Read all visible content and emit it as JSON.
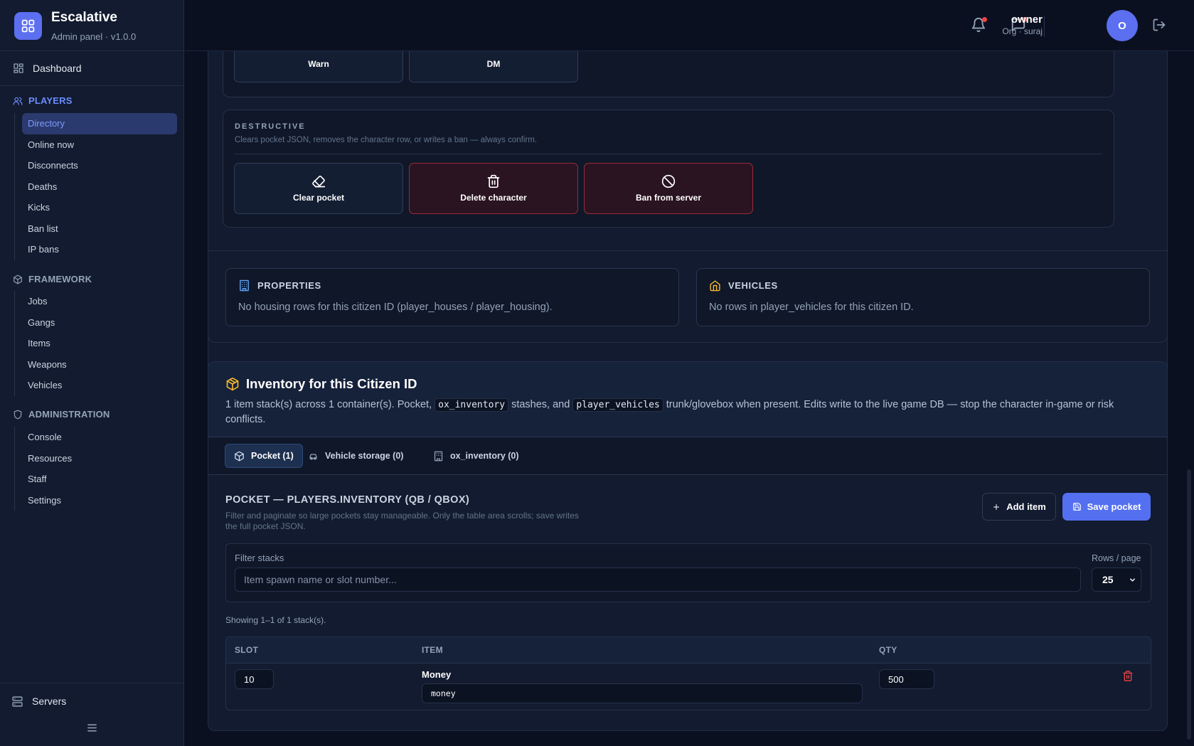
{
  "brand": {
    "title": "Escalative",
    "subtitle": "Admin panel · v1.0.0",
    "logo_icon": "grid-icon"
  },
  "sidebar": {
    "dashboard": "Dashboard",
    "sections": [
      {
        "label": "PLAYERS",
        "icon": "users-icon",
        "active": true,
        "items": [
          "Directory",
          "Online now",
          "Disconnects",
          "Deaths",
          "Kicks",
          "Ban list",
          "IP bans"
        ]
      },
      {
        "label": "FRAMEWORK",
        "icon": "cube-icon",
        "items": [
          "Jobs",
          "Gangs",
          "Items",
          "Weapons",
          "Vehicles"
        ]
      },
      {
        "label": "ADMINISTRATION",
        "icon": "shield-icon",
        "items": [
          "Console",
          "Resources",
          "Staff",
          "Settings"
        ]
      }
    ],
    "active_item": "Directory",
    "servers": "Servers"
  },
  "topbar": {
    "user_name": "owner",
    "user_sub": "Org · suraj",
    "avatar_initial": "O",
    "accent": "#5b6ff0",
    "notification_dot_color": "#ef4444"
  },
  "actions": {
    "warn": "Warn",
    "dm": "DM",
    "destructive_label": "DESTRUCTIVE",
    "destructive_desc": "Clears pocket JSON, removes the character row, or writes a ban — always confirm.",
    "clear_pocket": "Clear pocket",
    "delete_character": "Delete character",
    "ban_from_server": "Ban from server"
  },
  "properties": {
    "title": "PROPERTIES",
    "body": "No housing rows for this citizen ID (player_houses / player_housing)."
  },
  "vehicles": {
    "title": "VEHICLES",
    "body": "No rows in player_vehicles for this citizen ID."
  },
  "inventory": {
    "title": "Inventory for this Citizen ID",
    "desc_1": "1 item stack(s) across 1 container(s). Pocket, ",
    "code_1": "ox_inventory",
    "desc_2": " stashes, and ",
    "code_2": "player_vehicles",
    "desc_3": " trunk/glovebox when present. Edits write to the live game DB — stop the character in-game or risk conflicts.",
    "tabs": [
      {
        "label": "Pocket (1)",
        "icon": "cube-icon",
        "active": true
      },
      {
        "label": "Vehicle storage (0)",
        "icon": "car-icon"
      },
      {
        "label": "ox_inventory (0)",
        "icon": "building-icon"
      }
    ],
    "pocket_title": "POCKET — PLAYERS.INVENTORY (QB / QBOX)",
    "pocket_desc": "Filter and paginate so large pockets stay manageable. Only the table area scrolls; save writes the full pocket JSON.",
    "add_item": "Add item",
    "save_pocket": "Save pocket",
    "filter_label": "Filter stacks",
    "filter_placeholder": "Item spawn name or slot number...",
    "rows_label": "Rows / page",
    "rows_value": "25",
    "showing": "Showing 1–1 of 1 stack(s).",
    "columns": {
      "slot": "SLOT",
      "item": "ITEM",
      "qty": "QTY"
    },
    "rows": [
      {
        "slot": "10",
        "item": "Money",
        "spawn": "money",
        "qty": "500"
      }
    ]
  }
}
